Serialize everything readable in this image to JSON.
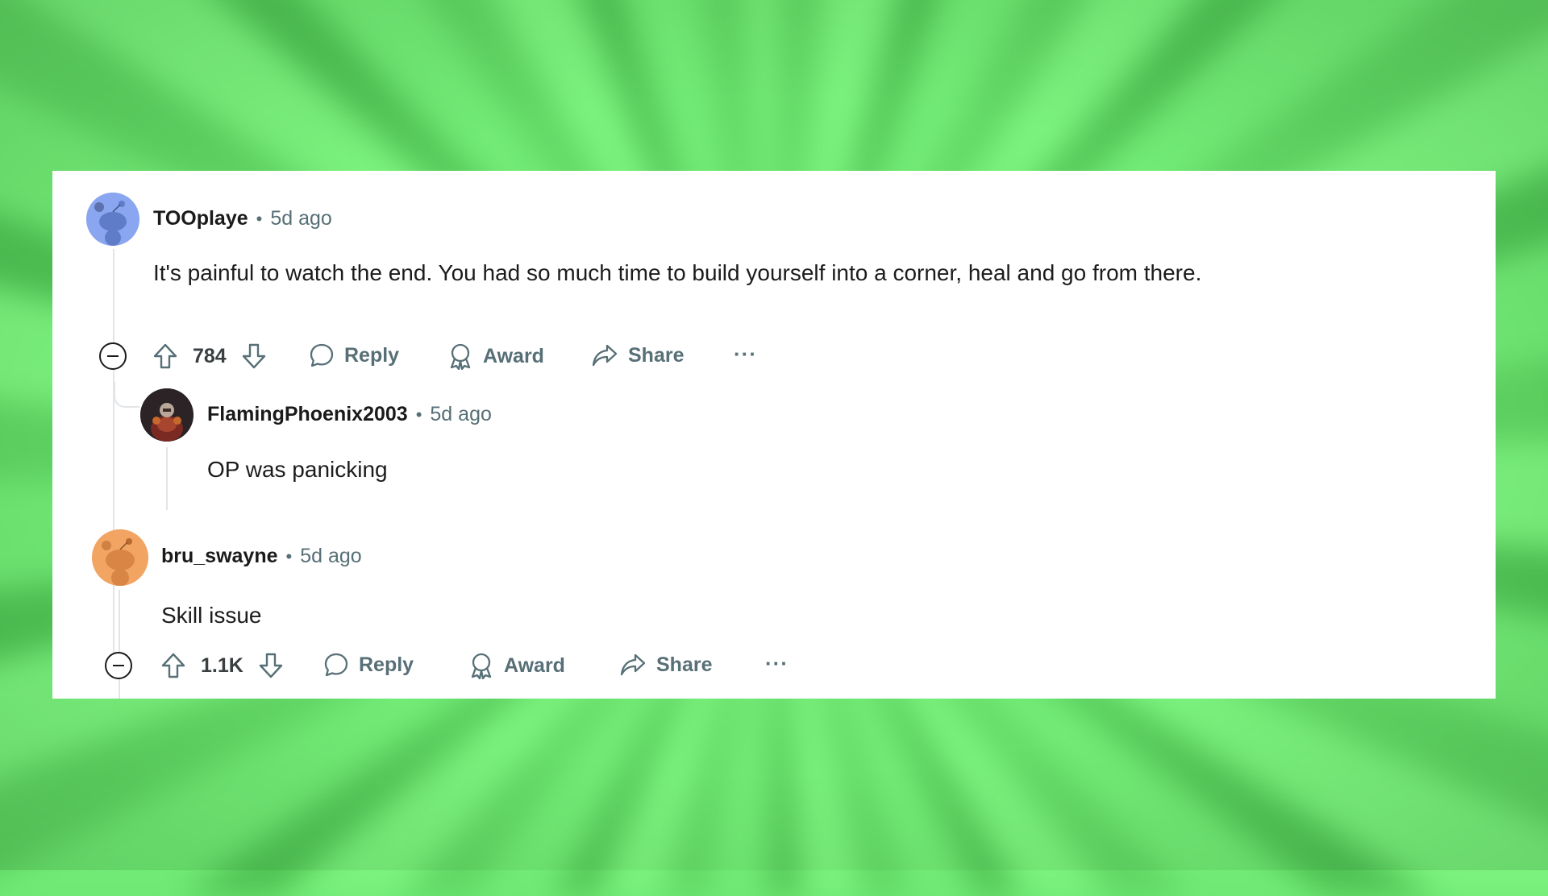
{
  "comments": [
    {
      "username": "TOOplaye",
      "separator": "•",
      "time": "5d ago",
      "body": "It's painful to watch the end. You had so much time to build yourself into a corner, heal and go from there.",
      "score": "784",
      "actions": {
        "reply": "Reply",
        "award": "Award",
        "share": "Share",
        "more": "···"
      },
      "avatar_color": "#8aa6f0",
      "reply": {
        "username": "FlamingPhoenix2003",
        "separator": "•",
        "time": "5d ago",
        "body": "OP was panicking"
      }
    },
    {
      "username": "bru_swayne",
      "separator": "•",
      "time": "5d ago",
      "body": "Skill issue",
      "score": "1.1K",
      "actions": {
        "reply": "Reply",
        "award": "Award",
        "share": "Share",
        "more": "···"
      },
      "avatar_color": "#f2a463"
    }
  ],
  "colors": {
    "background": "#6fe873",
    "card": "#ffffff",
    "meta_text": "#576f76",
    "thread_line": "#e2e5e7"
  }
}
